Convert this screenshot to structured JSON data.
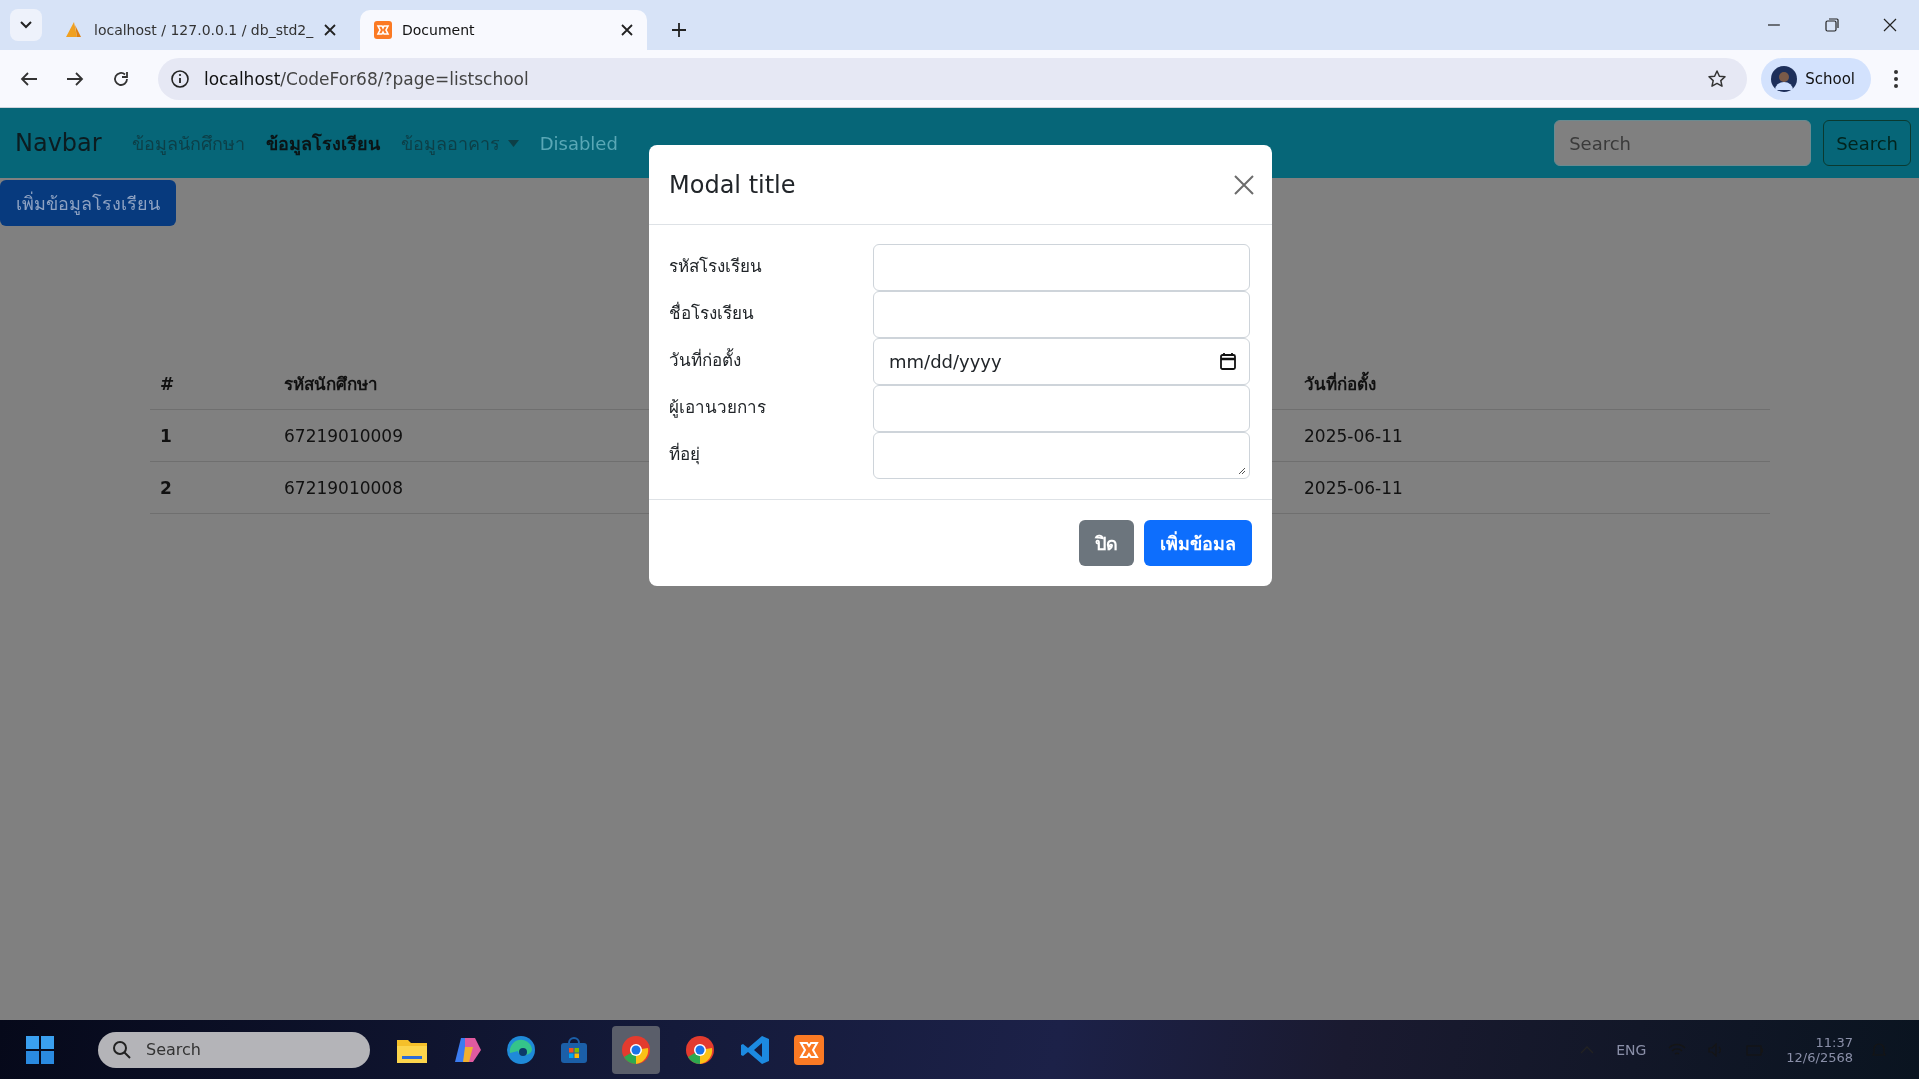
{
  "browser": {
    "tabs": [
      {
        "title": "localhost / 127.0.0.1 / db_std2_",
        "selected": false
      },
      {
        "title": "Document",
        "selected": true
      }
    ],
    "url_host": "localhost",
    "url_path": "/CodeFor68/?page=listschool",
    "profile": "School"
  },
  "navbar": {
    "brand": "Navbar",
    "links": [
      {
        "label": "ข้อมูลนักศึกษา",
        "active": false,
        "disabled": false,
        "dropdown": false
      },
      {
        "label": "ข้อมูลโรงเรียน",
        "active": true,
        "disabled": false,
        "dropdown": false
      },
      {
        "label": "ข้อมูลอาคาร",
        "active": false,
        "disabled": false,
        "dropdown": true
      },
      {
        "label": "Disabled",
        "active": false,
        "disabled": true,
        "dropdown": false
      }
    ],
    "search_placeholder": "Search",
    "search_button": "Search"
  },
  "page": {
    "add_button": "เพิ่มข้อมูลโรงเรียน",
    "table": {
      "columns": [
        "#",
        "รหัสนักศึกษา",
        "วันที่ก่อตั้ง"
      ],
      "rows": [
        [
          "1",
          "67219010009",
          "2025-06-11"
        ],
        [
          "2",
          "67219010008",
          "2025-06-11"
        ]
      ]
    }
  },
  "modal": {
    "title": "Modal title",
    "fields": [
      {
        "label": "รหัสโรงเรียน",
        "kind": "text"
      },
      {
        "label": "ชื่อโรงเรียน",
        "kind": "text"
      },
      {
        "label": "วันที่ก่อตั้ง",
        "kind": "date",
        "placeholder": "mm/dd/yyyy"
      },
      {
        "label": "ผู้เอานวยการ",
        "kind": "text"
      },
      {
        "label": "ที่อยุ่",
        "kind": "textarea"
      }
    ],
    "buttons": [
      {
        "label": "ปิด",
        "kind": "secondary"
      },
      {
        "label": "เพิ่มข้อมล",
        "kind": "primary"
      }
    ]
  },
  "taskbar": {
    "search_placeholder": "Search",
    "language": "ENG",
    "time": "11:37",
    "date": "12/6/2568"
  }
}
